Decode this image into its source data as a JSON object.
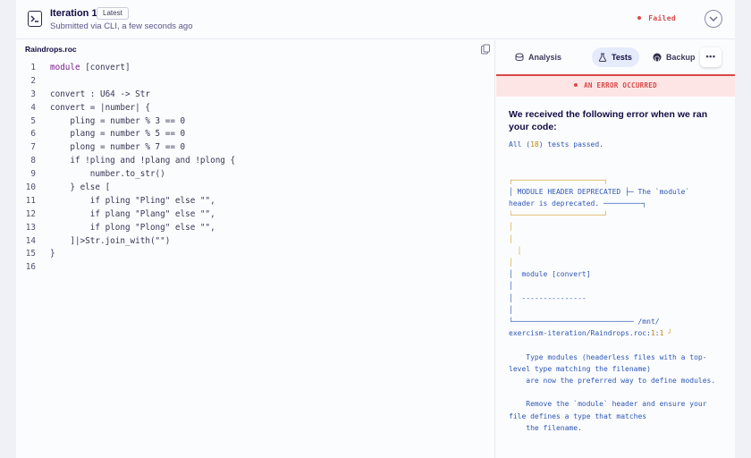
{
  "header": {
    "title": "Iteration 1",
    "badge": "Latest",
    "subtitle": "Submitted via CLI, a few seconds ago",
    "status": "Failed"
  },
  "editor": {
    "filename": "Raindrops.roc",
    "lines": [
      {
        "n": "1",
        "kw": "module",
        "text": " [convert]"
      },
      {
        "n": "2",
        "kw": "",
        "text": ""
      },
      {
        "n": "3",
        "kw": "",
        "text": "convert : U64 -> Str"
      },
      {
        "n": "4",
        "kw": "",
        "text": "convert = |number| {"
      },
      {
        "n": "5",
        "kw": "",
        "text": "    pling = number % 3 == 0"
      },
      {
        "n": "6",
        "kw": "",
        "text": "    plang = number % 5 == 0"
      },
      {
        "n": "7",
        "kw": "",
        "text": "    plong = number % 7 == 0"
      },
      {
        "n": "8",
        "kw": "",
        "text": "    if !pling and !plang and !plong {"
      },
      {
        "n": "9",
        "kw": "",
        "text": "        number.to_str()"
      },
      {
        "n": "10",
        "kw": "",
        "text": "    } else ["
      },
      {
        "n": "11",
        "kw": "",
        "text": "        if pling \"Pling\" else \"\","
      },
      {
        "n": "12",
        "kw": "",
        "text": "        if plang \"Plang\" else \"\","
      },
      {
        "n": "13",
        "kw": "",
        "text": "        if plong \"Plong\" else \"\","
      },
      {
        "n": "14",
        "kw": "",
        "text": "    ]|>Str.join_with(\"\")"
      },
      {
        "n": "15",
        "kw": "",
        "text": "}"
      },
      {
        "n": "16",
        "kw": "",
        "text": ""
      }
    ]
  },
  "tabs": {
    "analysis": "Analysis",
    "tests": "Tests",
    "backup": "Backup",
    "more": "•••"
  },
  "error": {
    "banner": "AN ERROR OCCURRED",
    "heading": "We received the following error when we ran your code:",
    "summary_pre": "All (",
    "summary_num": "18",
    "summary_post": ") tests passed.",
    "box_top": "┌─────────────────────┐",
    "box_mid": "│ MODULE HEADER DEPRECATED ├─ The `module`\nheader is deprecated. ─────────┐",
    "box_bot": "└─────────────────────┘",
    "trace_a": "│\n│\n  │\n│",
    "trace_b": "│  module [convert]\n│\n│  ---------------\n│",
    "trace_c": "└──────────────────────────── /mnt/\nexercism-iteration/Raindrops.roc:",
    "loc_line": "1",
    "loc_sep": ":",
    "loc_col": "1",
    "trace_end": " ╯",
    "message": "    Type modules (headerless files with a top-\nlevel type matching the filename)\n    are now the preferred way to define modules.\n\n    Remove the `module` header and ensure your\nfile defines a type that matches\n    the filename."
  }
}
